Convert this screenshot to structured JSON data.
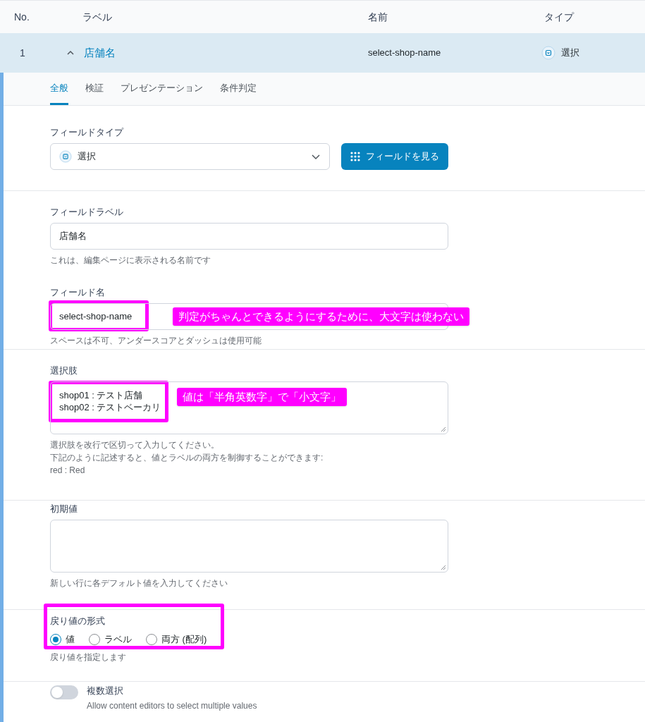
{
  "table": {
    "columns": [
      "No.",
      "ラベル",
      "名前",
      "タイプ"
    ],
    "rows": [
      {
        "no": "1",
        "label": "店舗名",
        "name": "select-shop-name",
        "type": "選択",
        "expanded": true,
        "selected": true
      }
    ]
  },
  "tabs": [
    {
      "label": "全般",
      "selected": true
    },
    {
      "label": "検証",
      "selected": false
    },
    {
      "label": "プレゼンテーション",
      "selected": false
    },
    {
      "label": "条件判定",
      "selected": false
    }
  ],
  "settings": [
    {
      "kind": "type_select",
      "label": "フィールドタイプ",
      "value": "選択",
      "button": "フィールドを見る"
    },
    {
      "kind": "text",
      "label": "フィールドラベル",
      "value": "店舗名",
      "help": [
        "これは、編集ページに表示される名前です"
      ]
    },
    {
      "kind": "text",
      "label": "フィールド名",
      "value": "select-shop-name",
      "help": [
        "スペースは不可、アンダースコアとダッシュは使用可能"
      ],
      "highlighted": true,
      "note": "判定がちゃんとできるようにするために、大文字は使わない"
    },
    {
      "kind": "textarea",
      "label": "選択肢",
      "lines": [
        "shop01 : テスト店舗",
        "shop02 : テストベーカリ"
      ],
      "help": [
        "選択肢を改行で区切って入力してください。",
        "下記のように記述すると、値とラベルの両方を制御することができます:",
        "red : Red"
      ],
      "highlighted": true,
      "note": "値は「半角英数字」で「小文字」"
    },
    {
      "kind": "textarea",
      "label": "初期値",
      "help": [
        "新しい行に各デフォルト値を入力してください"
      ]
    },
    {
      "kind": "radio",
      "label": "戻り値の形式",
      "options": [
        {
          "label": "値",
          "selected": true
        },
        {
          "label": "ラベル",
          "selected": false
        },
        {
          "label": "両方 (配列)",
          "selected": false
        }
      ],
      "help": [
        "戻り値を指定します"
      ],
      "highlighted": true
    },
    {
      "kind": "toggle",
      "label": "複数選択",
      "on": false,
      "description": "Allow content editors to select multiple values"
    }
  ]
}
